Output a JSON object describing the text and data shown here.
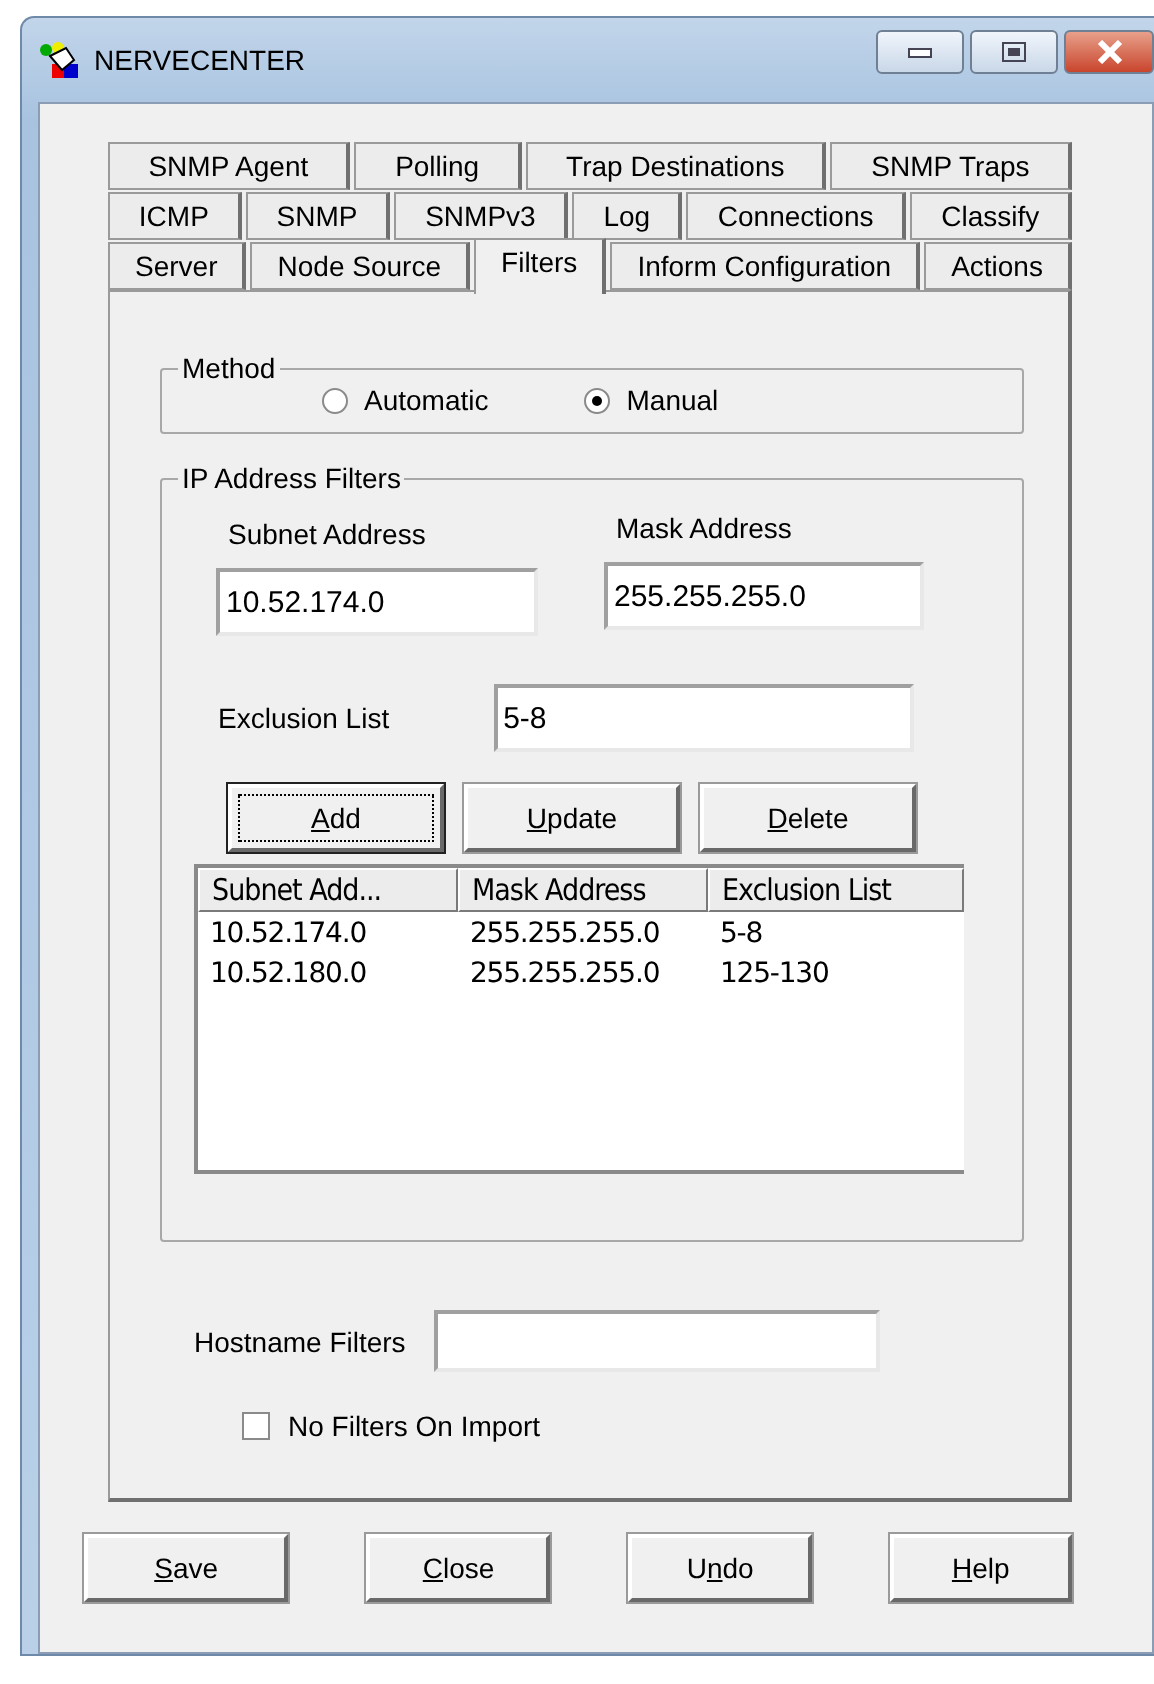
{
  "window": {
    "title": "NERVECENTER"
  },
  "tab_rows": [
    [
      {
        "label": "SNMP Agent",
        "selected": false
      },
      {
        "label": "Polling",
        "selected": false
      },
      {
        "label": "Trap Destinations",
        "selected": false
      },
      {
        "label": "SNMP Traps",
        "selected": false
      }
    ],
    [
      {
        "label": "ICMP",
        "selected": false
      },
      {
        "label": "SNMP",
        "selected": false
      },
      {
        "label": "SNMPv3",
        "selected": false
      },
      {
        "label": "Log",
        "selected": false
      },
      {
        "label": "Connections",
        "selected": false
      },
      {
        "label": "Classify",
        "selected": false
      }
    ],
    [
      {
        "label": "Server",
        "selected": false
      },
      {
        "label": "Node Source",
        "selected": false
      },
      {
        "label": "Filters",
        "selected": true
      },
      {
        "label": "Inform Configuration",
        "selected": false
      },
      {
        "label": "Actions",
        "selected": false
      }
    ]
  ],
  "method": {
    "title": "Method",
    "options": [
      {
        "label": "Automatic",
        "selected": false
      },
      {
        "label": "Manual",
        "selected": true
      }
    ]
  },
  "ip_filters": {
    "title": "IP Address Filters",
    "subnet_label": "Subnet Address",
    "subnet_value": "10.52.174.0",
    "mask_label": "Mask Address",
    "mask_value": "255.255.255.0",
    "exclusion_label": "Exclusion List",
    "exclusion_value": "5-8",
    "buttons": [
      {
        "label": "Add",
        "focused": true
      },
      {
        "label": "Update",
        "focused": false
      },
      {
        "label": "Delete",
        "focused": false
      }
    ],
    "table": {
      "columns": [
        "Subnet Add...",
        "Mask Address",
        "Exclusion List"
      ],
      "rows": [
        [
          "10.52.174.0",
          "255.255.255.0",
          "5-8"
        ],
        [
          "10.52.180.0",
          "255.255.255.0",
          "125-130"
        ]
      ]
    }
  },
  "hostname_filters": {
    "label": "Hostname Filters"
  },
  "no_filters_on_import": {
    "label": "No Filters On Import",
    "checked": false
  },
  "buttons": [
    {
      "label": "Save"
    },
    {
      "label": "Close"
    },
    {
      "label": "Undo"
    },
    {
      "label": "Help"
    }
  ]
}
